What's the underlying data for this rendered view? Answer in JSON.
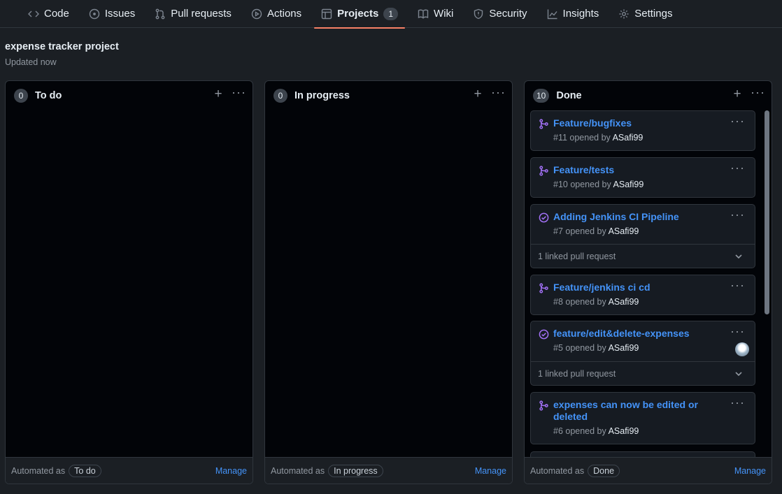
{
  "nav": {
    "tabs": [
      {
        "label": "Code",
        "icon": "code-icon"
      },
      {
        "label": "Issues",
        "icon": "issue-icon"
      },
      {
        "label": "Pull requests",
        "icon": "pull-request-icon"
      },
      {
        "label": "Actions",
        "icon": "play-icon"
      },
      {
        "label": "Projects",
        "icon": "table-icon",
        "count": "1",
        "active": true
      },
      {
        "label": "Wiki",
        "icon": "book-icon"
      },
      {
        "label": "Security",
        "icon": "shield-icon"
      },
      {
        "label": "Insights",
        "icon": "graph-icon"
      },
      {
        "label": "Settings",
        "icon": "gear-icon"
      }
    ]
  },
  "project": {
    "title": "expense tracker project",
    "updated": "Updated now"
  },
  "columns": [
    {
      "name": "To do",
      "count": "0",
      "automated_label": "Automated as",
      "automated_value": "To do",
      "manage": "Manage"
    },
    {
      "name": "In progress",
      "count": "0",
      "automated_label": "Automated as",
      "automated_value": "In progress",
      "manage": "Manage"
    },
    {
      "name": "Done",
      "count": "10",
      "automated_label": "Automated as",
      "automated_value": "Done",
      "manage": "Manage",
      "cards": [
        {
          "type": "pull-request",
          "title": "Feature/bugfixes",
          "meta": "#11 opened by",
          "user": "ASafi99"
        },
        {
          "type": "pull-request",
          "title": "Feature/tests",
          "meta": "#10 opened by",
          "user": "ASafi99"
        },
        {
          "type": "issue-closed",
          "title": "Adding Jenkins CI Pipeline",
          "meta": "#7 opened by",
          "user": "ASafi99",
          "linked": "1 linked pull request"
        },
        {
          "type": "pull-request",
          "title": "Feature/jenkins ci cd",
          "meta": "#8 opened by",
          "user": "ASafi99"
        },
        {
          "type": "issue-closed",
          "title": "feature/edit&delete-expenses",
          "meta": "#5 opened by",
          "user": "ASafi99",
          "linked": "1 linked pull request",
          "avatar": true
        },
        {
          "type": "pull-request",
          "title": "expenses can now be edited or deleted",
          "meta": "#6 opened by",
          "user": "ASafi99"
        }
      ]
    }
  ],
  "colors": {
    "accent_link": "#4493f8",
    "merged_purple": "#a371f7",
    "active_tab_underline": "#f78166"
  }
}
